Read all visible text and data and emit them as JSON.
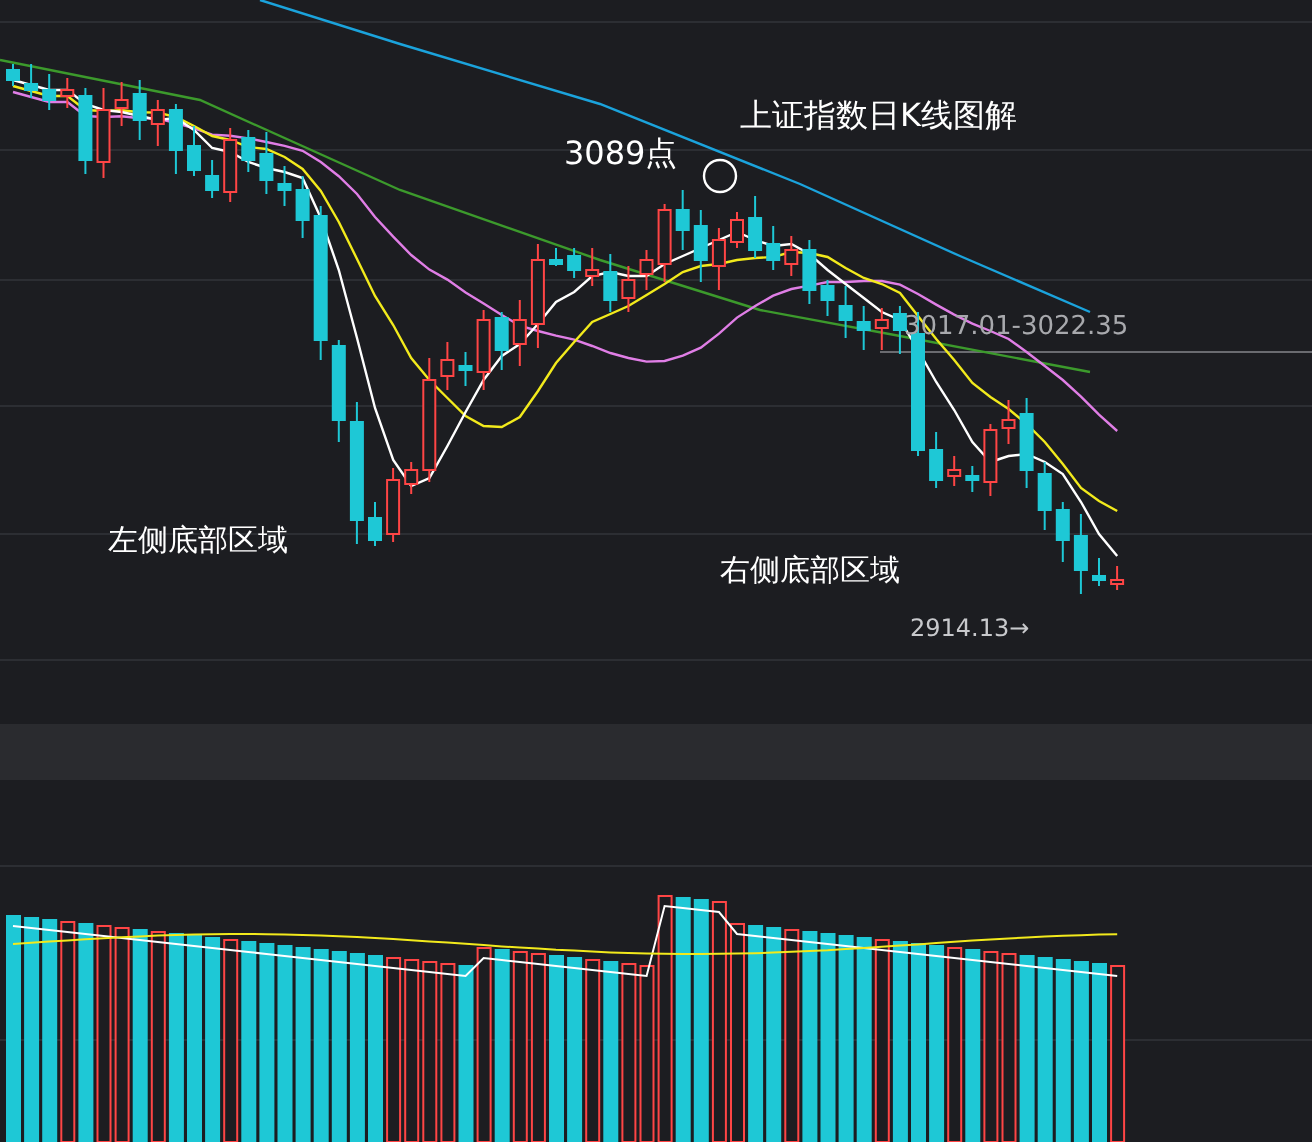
{
  "chart": {
    "title": "上证指数日K线图解",
    "peak_label": "3089点",
    "range_label": "3017.01-3022.35",
    "left_zone_label": "左侧底部区域",
    "right_zone_label": "右侧底部区域",
    "low_label": "2914.13→"
  }
}
